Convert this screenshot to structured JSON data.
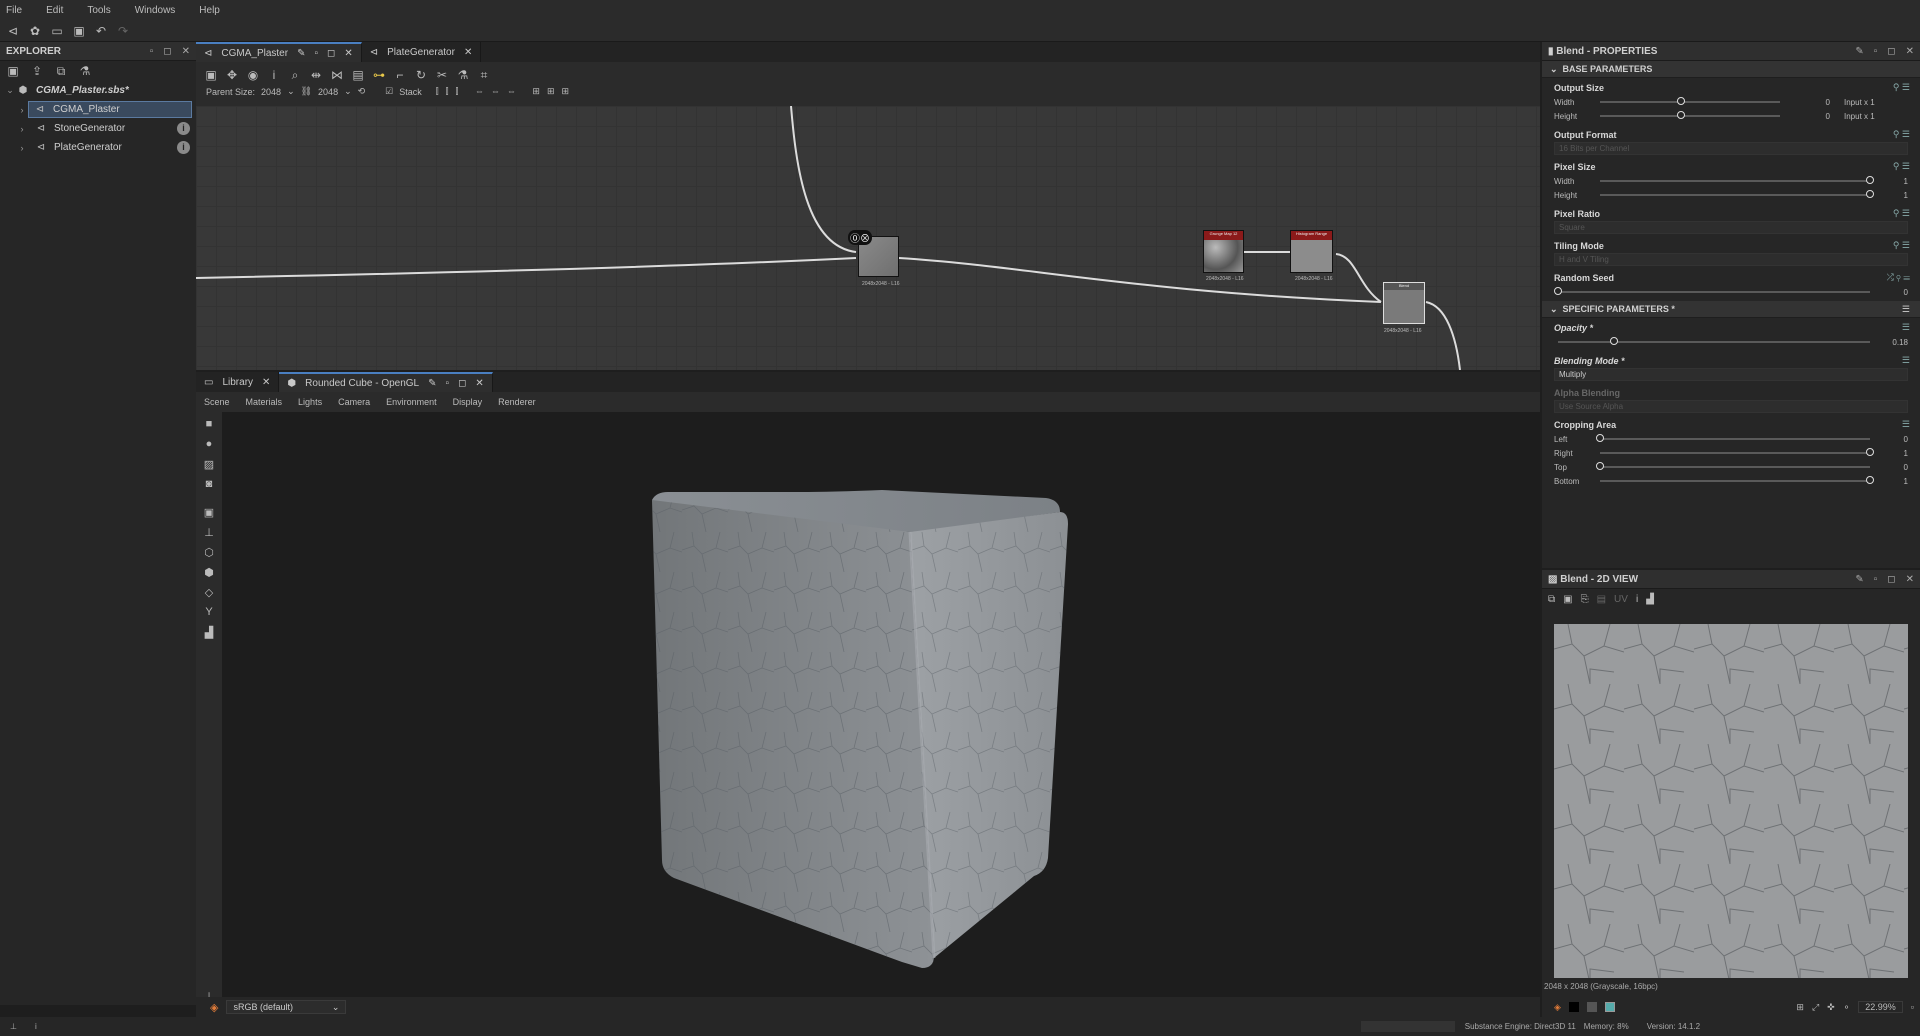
{
  "menu": [
    "File",
    "Edit",
    "Tools",
    "Windows",
    "Help"
  ],
  "explorer": {
    "title": "EXPLORER",
    "package": "CGMA_Plaster.sbs*",
    "items": [
      {
        "label": "CGMA_Plaster",
        "selected": true,
        "info": false
      },
      {
        "label": "StoneGenerator",
        "selected": false,
        "info": true
      },
      {
        "label": "PlateGenerator",
        "selected": false,
        "info": true
      }
    ]
  },
  "graph": {
    "tabs": [
      {
        "label": "CGMA_Plaster",
        "active": true
      },
      {
        "label": "PlateGenerator",
        "active": false
      }
    ],
    "parent_size_label": "Parent Size:",
    "parent_size_value": "2048",
    "size_value": "2048",
    "stack_label": "Stack",
    "nodes": [
      {
        "label": "2048x2048 - L16"
      },
      {
        "label": "2048x2048 - L16",
        "title": "Grunge Map 12"
      },
      {
        "label": "2048x2048 - L16",
        "title": "Histogram Range"
      },
      {
        "label": "2048x2048 - L16",
        "title": "Blend"
      }
    ]
  },
  "view3d": {
    "tabs": [
      {
        "label": "Library",
        "active": false
      },
      {
        "label": "Rounded Cube - OpenGL",
        "active": true
      }
    ],
    "menu": [
      "Scene",
      "Materials",
      "Lights",
      "Camera",
      "Environment",
      "Display",
      "Renderer"
    ],
    "colorspace": "sRGB (default)"
  },
  "properties": {
    "title": "Blend - PROPERTIES",
    "base_section": "BASE PARAMETERS",
    "specific_section": "SPECIFIC PARAMETERS *",
    "output_size": {
      "title": "Output Size",
      "width_label": "Width",
      "width_val": "0",
      "width_note": "Input x 1",
      "height_label": "Height",
      "height_val": "0",
      "height_note": "Input x 1"
    },
    "output_format": {
      "title": "Output Format",
      "value": "16 Bits per Channel"
    },
    "pixel_size": {
      "title": "Pixel Size",
      "width_label": "Width",
      "width_val": "1",
      "height_label": "Height",
      "height_val": "1"
    },
    "pixel_ratio": {
      "title": "Pixel Ratio",
      "value": "Square"
    },
    "tiling_mode": {
      "title": "Tiling Mode",
      "value": "H and V Tiling"
    },
    "random_seed": {
      "title": "Random Seed",
      "value": "0"
    },
    "opacity": {
      "title": "Opacity *",
      "value": "0.18",
      "fraction": 0.18
    },
    "blending_mode": {
      "title": "Blending Mode *",
      "value": "Multiply"
    },
    "alpha_blending": {
      "title": "Alpha Blending",
      "value": "Use Source Alpha"
    },
    "cropping": {
      "title": "Cropping Area",
      "rows": [
        {
          "label": "Left",
          "val": "0",
          "fraction": 0
        },
        {
          "label": "Right",
          "val": "1",
          "fraction": 1
        },
        {
          "label": "Top",
          "val": "0",
          "fraction": 0
        },
        {
          "label": "Bottom",
          "val": "1",
          "fraction": 1
        }
      ]
    }
  },
  "view2d": {
    "title": "Blend - 2D VIEW",
    "uv_label": "UV",
    "info": "2048 x 2048 (Grayscale, 16bpc)",
    "zoom": "22.99%"
  },
  "status": {
    "engine": "Substance Engine: Direct3D 11",
    "memory": "Memory: 8%",
    "version": "Version: 14.1.2"
  },
  "colors": {
    "accent": "#4a7fc1",
    "node_header_red": "#8b1a1a",
    "selection": "#3a4a5e"
  }
}
